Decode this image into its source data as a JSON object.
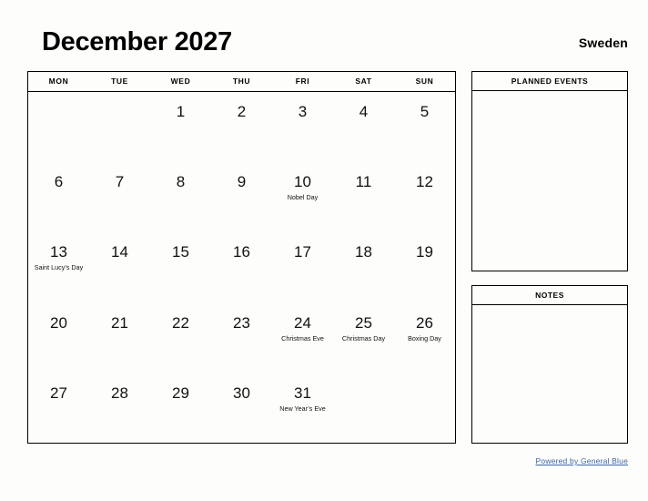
{
  "header": {
    "month_title": "December 2027",
    "country": "Sweden"
  },
  "calendar": {
    "weekday_headers": [
      "MON",
      "TUE",
      "WED",
      "THU",
      "FRI",
      "SAT",
      "SUN"
    ],
    "weeks": [
      [
        {
          "day": "",
          "event": ""
        },
        {
          "day": "",
          "event": ""
        },
        {
          "day": "1",
          "event": ""
        },
        {
          "day": "2",
          "event": ""
        },
        {
          "day": "3",
          "event": ""
        },
        {
          "day": "4",
          "event": ""
        },
        {
          "day": "5",
          "event": ""
        }
      ],
      [
        {
          "day": "6",
          "event": ""
        },
        {
          "day": "7",
          "event": ""
        },
        {
          "day": "8",
          "event": ""
        },
        {
          "day": "9",
          "event": ""
        },
        {
          "day": "10",
          "event": "Nobel Day"
        },
        {
          "day": "11",
          "event": ""
        },
        {
          "day": "12",
          "event": ""
        }
      ],
      [
        {
          "day": "13",
          "event": "Saint Lucy’s Day"
        },
        {
          "day": "14",
          "event": ""
        },
        {
          "day": "15",
          "event": ""
        },
        {
          "day": "16",
          "event": ""
        },
        {
          "day": "17",
          "event": ""
        },
        {
          "day": "18",
          "event": ""
        },
        {
          "day": "19",
          "event": ""
        }
      ],
      [
        {
          "day": "20",
          "event": ""
        },
        {
          "day": "21",
          "event": ""
        },
        {
          "day": "22",
          "event": ""
        },
        {
          "day": "23",
          "event": ""
        },
        {
          "day": "24",
          "event": "Christmas Eve"
        },
        {
          "day": "25",
          "event": "Christmas Day"
        },
        {
          "day": "26",
          "event": "Boxing Day"
        }
      ],
      [
        {
          "day": "27",
          "event": ""
        },
        {
          "day": "28",
          "event": ""
        },
        {
          "day": "29",
          "event": ""
        },
        {
          "day": "30",
          "event": ""
        },
        {
          "day": "31",
          "event": "New Year’s Eve"
        },
        {
          "day": "",
          "event": ""
        },
        {
          "day": "",
          "event": ""
        }
      ]
    ]
  },
  "side_panels": {
    "planned_events": {
      "title": "PLANNED EVENTS",
      "content": ""
    },
    "notes": {
      "title": "NOTES",
      "content": ""
    }
  },
  "footer": {
    "link_label": "Powered by General Blue",
    "link_color": "#3a66b0"
  }
}
